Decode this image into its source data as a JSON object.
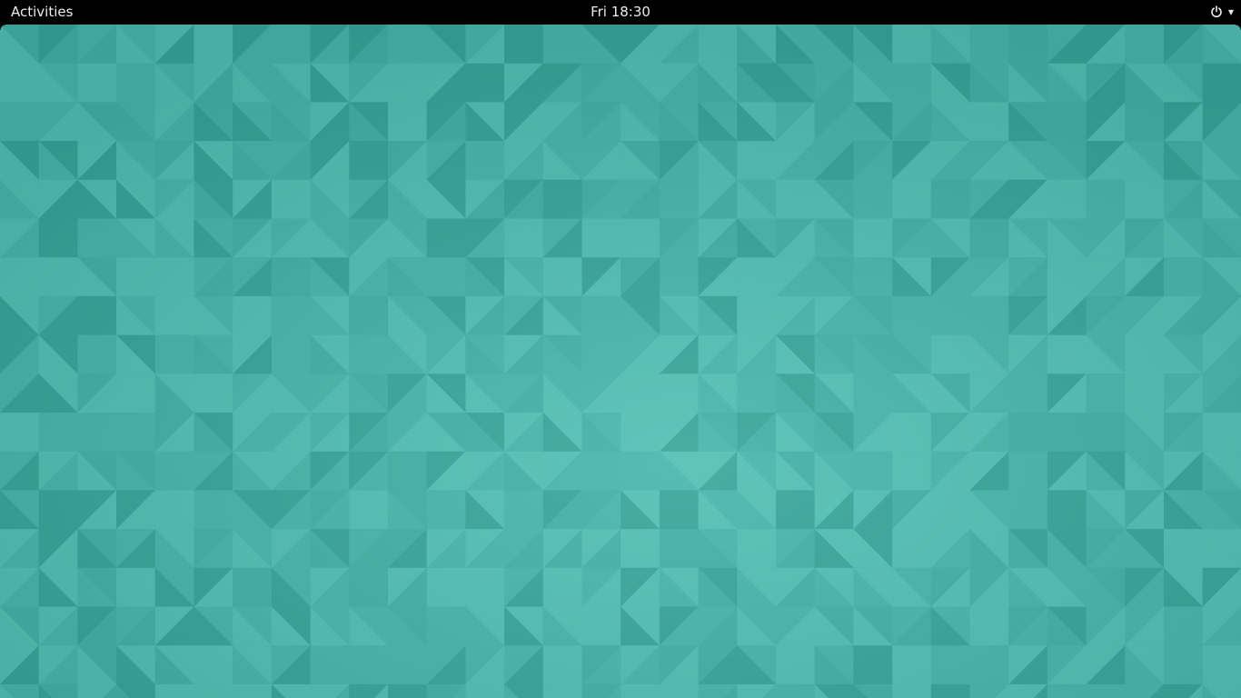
{
  "topbar": {
    "activities_label": "Activities",
    "clock_text": "Fri 18:30",
    "system_menu": {
      "power_icon": "power-icon",
      "arrow_icon": "dropdown-arrow-icon",
      "arrow_glyph": "▾"
    }
  },
  "desktop": {
    "wallpaper": "geometric-teal-triangles",
    "colors": {
      "base": "#3fb0a6",
      "light": "#5ccbbf",
      "dark": "#2e9a90",
      "mid": "#49b9ae"
    }
  }
}
